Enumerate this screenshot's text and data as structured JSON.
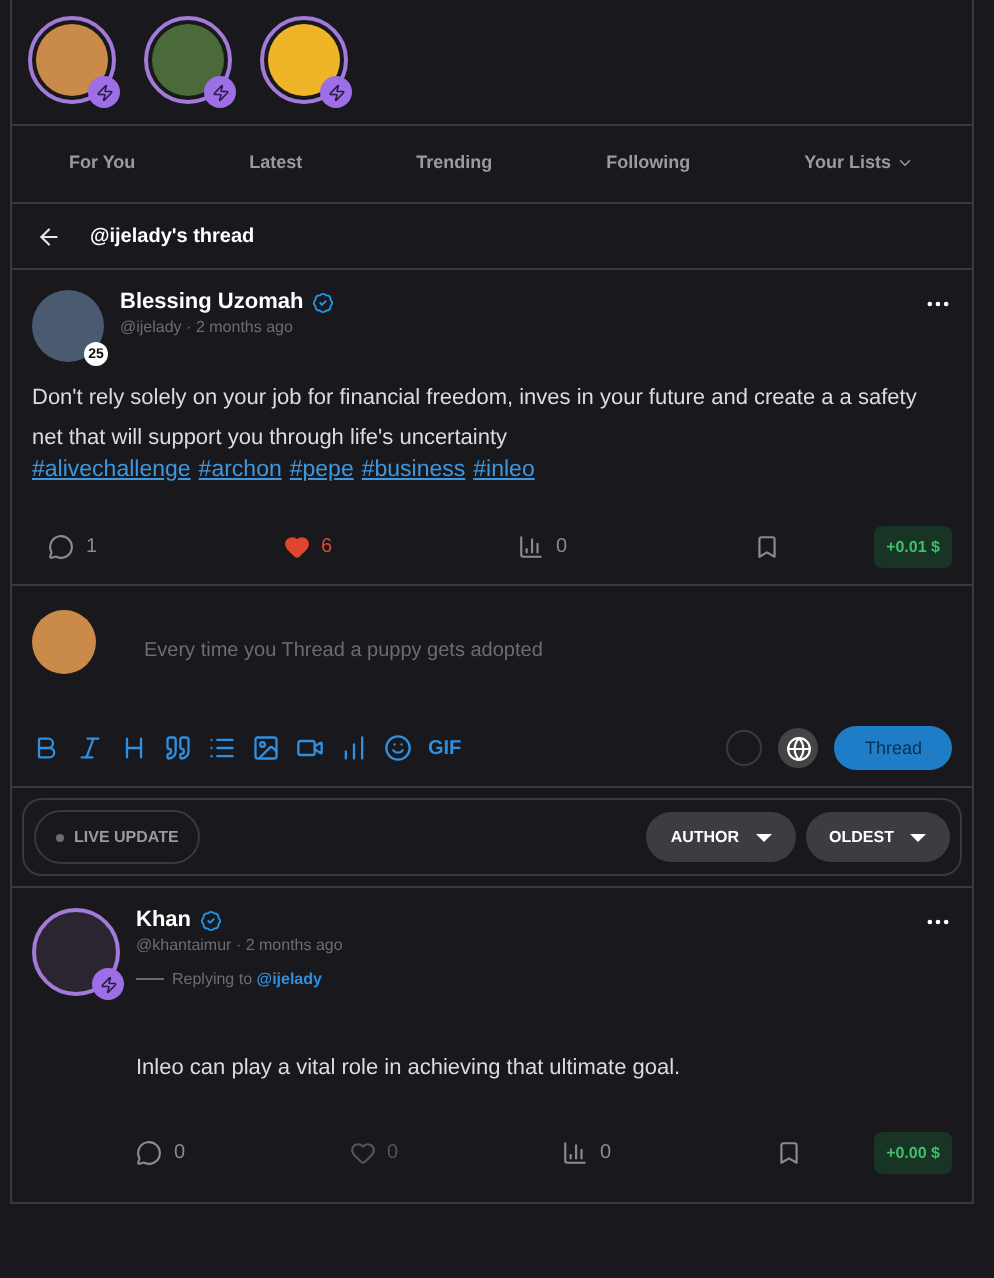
{
  "stories": [
    {
      "color": "#c98a4a"
    },
    {
      "color": "#4a6a3a"
    },
    {
      "color": "#f0b429"
    }
  ],
  "tabs": [
    {
      "label": "For You",
      "selected": false
    },
    {
      "label": "Latest",
      "selected": false
    },
    {
      "label": "Trending",
      "selected": false
    },
    {
      "label": "Following",
      "selected": false
    },
    {
      "label": "Your Lists",
      "selected": false,
      "dropdown": true
    }
  ],
  "thread_header": {
    "title": "@ijelady's thread"
  },
  "post": {
    "name": "Blessing Uzomah",
    "verified": true,
    "handle": "@ijelady",
    "separator": "·",
    "time": "2 months ago",
    "reputation": "25",
    "text": "Don't rely solely on your job for financial freedom, inves in your future and create a a safety net that will support you through life's uncertainty",
    "tags": [
      "#alivechallenge",
      "#archon",
      "#pepe",
      "#business",
      "#inleo"
    ],
    "comments": "1",
    "likes": "6",
    "liked": true,
    "votes": "0",
    "earnings": "+0.01 $"
  },
  "composer": {
    "placeholder": "Every time you Thread a puppy gets adopted",
    "toolbar": [
      {
        "kind": "bold"
      },
      {
        "kind": "italic"
      },
      {
        "kind": "heading"
      },
      {
        "kind": "quote"
      },
      {
        "kind": "list"
      },
      {
        "kind": "image"
      },
      {
        "kind": "video"
      },
      {
        "kind": "chart"
      },
      {
        "kind": "emoji"
      },
      {
        "kind": "gif",
        "label": "GIF"
      }
    ],
    "button": "Thread"
  },
  "filters": {
    "live": "LIVE UPDATE",
    "sorts": [
      "AUTHOR",
      "OLDEST"
    ]
  },
  "reply": {
    "name": "Khan",
    "verified": true,
    "handle": "@khantaimur",
    "separator": "·",
    "time": "2 months ago",
    "replying_label": "Replying to",
    "replying_to": "@ijelady",
    "text": "Inleo can play a vital role in achieving that ultimate goal.",
    "comments": "0",
    "likes": "0",
    "liked": false,
    "votes": "0",
    "earnings": "+0.00 $"
  }
}
